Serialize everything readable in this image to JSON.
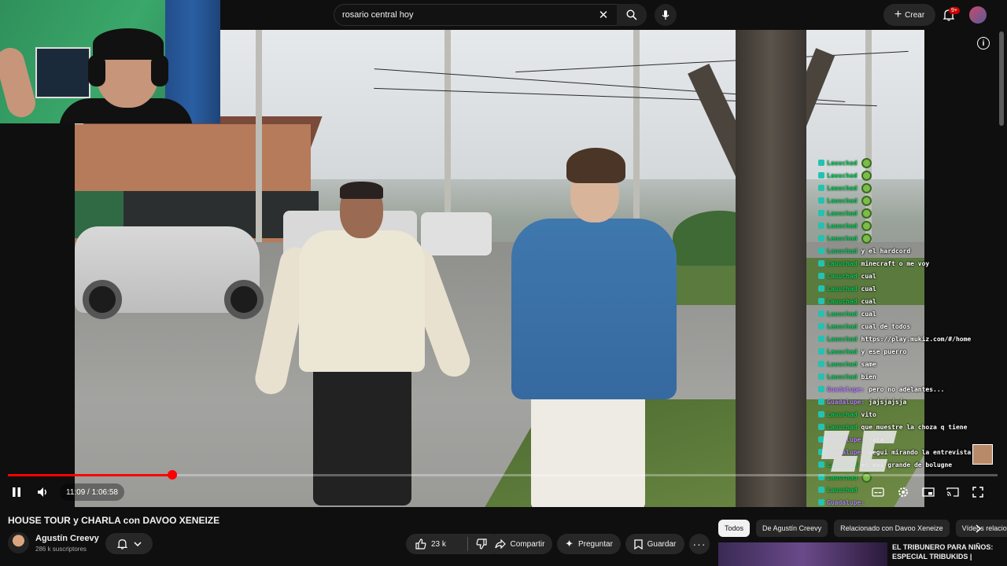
{
  "search": {
    "query": "rosario central hoy"
  },
  "header": {
    "create_label": "Crear",
    "notifications_badge": "9+"
  },
  "player": {
    "time_current": "11:09",
    "time_total": "1:06:58",
    "time_label": "11:09 / 1:06:58",
    "progress_fraction": 0.1665
  },
  "chat": [
    {
      "user": "Lauuchad",
      "msg": "",
      "emote": true,
      "color": "green"
    },
    {
      "user": "Lauuchad",
      "msg": "",
      "emote": true,
      "color": "green"
    },
    {
      "user": "Lauuchad",
      "msg": "",
      "emote": true,
      "color": "green"
    },
    {
      "user": "Lauuchad",
      "msg": "",
      "emote": true,
      "color": "green"
    },
    {
      "user": "Lauuchad",
      "msg": "",
      "emote": true,
      "color": "green"
    },
    {
      "user": "Lauuchad",
      "msg": "",
      "emote": true,
      "color": "green"
    },
    {
      "user": "Lauuchad",
      "msg": "",
      "emote": true,
      "color": "green"
    },
    {
      "user": "Lauuchad",
      "msg": "y el hardcord",
      "emote": false,
      "color": "green"
    },
    {
      "user": "Lauuchad",
      "msg": "minecraft o me voy",
      "emote": false,
      "color": "green"
    },
    {
      "user": "Lauuchad",
      "msg": "cual",
      "emote": false,
      "color": "green"
    },
    {
      "user": "Lauuchad",
      "msg": "cual",
      "emote": false,
      "color": "green"
    },
    {
      "user": "Lauuchad",
      "msg": "cual",
      "emote": false,
      "color": "green"
    },
    {
      "user": "Lauuchad",
      "msg": "cual",
      "emote": false,
      "color": "green"
    },
    {
      "user": "Lauuchad",
      "msg": "cual de todos",
      "emote": false,
      "color": "green"
    },
    {
      "user": "Lauuchad",
      "msg": "https://play.mukiz.com/#/home",
      "emote": false,
      "color": "green"
    },
    {
      "user": "Lauuchad",
      "msg": "y ese puerro",
      "emote": false,
      "color": "green"
    },
    {
      "user": "Lauuchad",
      "msg": "same",
      "emote": false,
      "color": "green"
    },
    {
      "user": "Lauuchad",
      "msg": "bien",
      "emote": false,
      "color": "green"
    },
    {
      "user": "Guadalupe:",
      "msg": "pero no adelantes...",
      "emote": false,
      "color": "purple"
    },
    {
      "user": "Guadalupe:",
      "msg": "jajsjajsja",
      "emote": false,
      "color": "purple"
    },
    {
      "user": "Lauuchad",
      "msg": "vito",
      "emote": false,
      "color": "green"
    },
    {
      "user": "Lauuchad",
      "msg": "que muestre la choza q tiene",
      "emote": false,
      "color": "green"
    },
    {
      "user": "Guadalupe:",
      "msg": "rata",
      "emote": false,
      "color": "purple"
    },
    {
      "user": "Guadalupe:",
      "msg": "segui mirando la entrevista",
      "emote": false,
      "color": "purple"
    },
    {
      "user": "Lauuchad",
      "msg": "el mas grande de bolugne",
      "emote": false,
      "color": "green"
    },
    {
      "user": "Lauuchad",
      "msg": "",
      "emote": true,
      "color": "green"
    },
    {
      "user": "Lauuchad",
      "msg": "",
      "emote": false,
      "color": "green"
    },
    {
      "user": "Guadalupe:",
      "msg": "",
      "emote": false,
      "color": "purple"
    },
    {
      "user": "Lauuchad",
      "msg": "",
      "emote": false,
      "color": "green"
    }
  ],
  "video": {
    "title": "HOUSE TOUR y CHARLA con DAVOO XENEIZE",
    "channel_name": "Agustín Creevy",
    "channel_subs": "286 k suscriptores",
    "likes": "23 k",
    "share_label": "Compartir",
    "ask_label": "Preguntar",
    "save_label": "Guardar"
  },
  "sidebar": {
    "chips": [
      "Todos",
      "De Agustín Creevy",
      "Relacionado con Davoo Xeneize",
      "Vídeos relacionados"
    ],
    "rec_title": "EL TRIBUNERO PARA NIÑOS: ESPECIAL TRIBUKIDS |"
  },
  "colors": {
    "accent": "#ff0000",
    "chat_user": "#00c853",
    "chat_user_alt": "#b27cff",
    "bg": "#0f0f0f"
  },
  "icons": [
    "search-icon",
    "clear-icon",
    "mic-icon",
    "plus-icon",
    "bell-icon",
    "info-icon",
    "pause-icon",
    "volume-icon",
    "subtitles-icon",
    "settings-icon",
    "miniplayer-icon",
    "cast-icon",
    "fullscreen-icon",
    "like-icon",
    "dislike-icon",
    "share-icon",
    "sparkle-icon",
    "bookmark-icon",
    "more-icon",
    "chevron-right-icon",
    "chevron-down-icon"
  ]
}
